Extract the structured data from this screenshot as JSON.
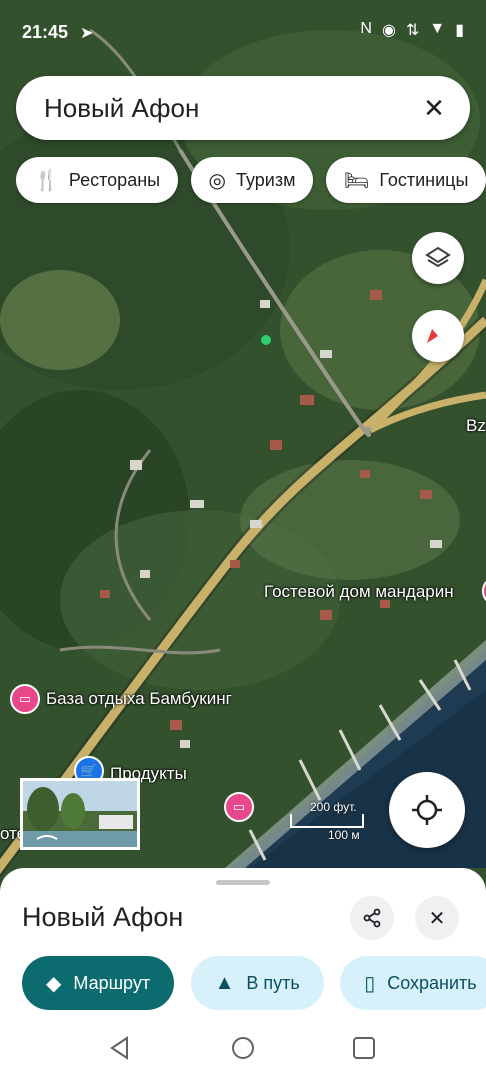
{
  "status_bar": {
    "time": "21:45",
    "nav_glyph": "➤",
    "right_icons": [
      "N",
      "◉",
      "⇅",
      "▼",
      "▮"
    ]
  },
  "search": {
    "query": "Новый Афон",
    "close_icon": "close-icon"
  },
  "chips": [
    {
      "label": "Рестораны",
      "icon": "fork-knife-icon",
      "glyph": "🍴"
    },
    {
      "label": "Туризм",
      "icon": "camera-icon",
      "glyph": "📷"
    },
    {
      "label": "Гостиницы",
      "icon": "bed-icon",
      "glyph": "🛏"
    }
  ],
  "map": {
    "labels": {
      "guesthouse": "Гостевой дом мандарин",
      "bambooking": "База отдыха Бамбукинг",
      "products": "Продукты",
      "bz": "Bz",
      "partial_left": "оте"
    },
    "scale": {
      "feet": "200 фут.",
      "meters": "100 м"
    },
    "colors": {
      "road": "#c9b16a",
      "pin_pink": "#e8488a",
      "pin_blue": "#1a73e8"
    }
  },
  "sheet": {
    "title": "Новый Афон",
    "actions": [
      {
        "label": "Маршрут",
        "icon": "directions-icon",
        "glyph": "◆",
        "style": "primary"
      },
      {
        "label": "В путь",
        "icon": "navigation-arrow-icon",
        "glyph": "▲",
        "style": "secondary"
      },
      {
        "label": "Сохранить",
        "icon": "bookmark-icon",
        "glyph": "▯",
        "style": "secondary"
      }
    ]
  },
  "colors": {
    "accent": "#0b6b6e",
    "chip_bg": "#d7f1fb"
  }
}
